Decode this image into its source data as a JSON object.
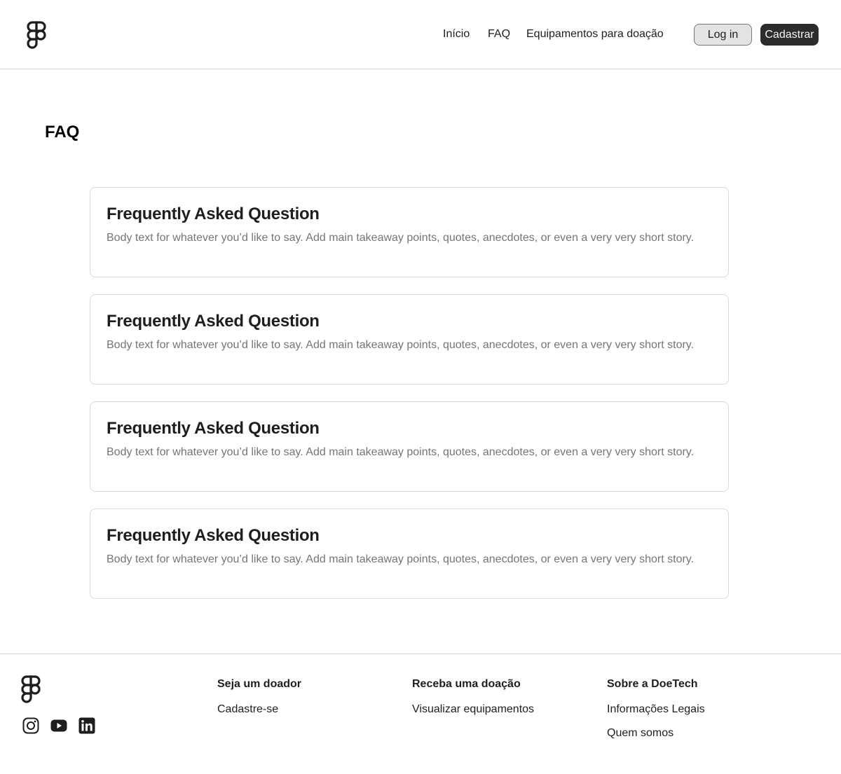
{
  "header": {
    "logo_icon": "figma-logo-icon",
    "nav": {
      "inicio": "Início",
      "faq": "FAQ",
      "equipamentos": "Equipamentos para doação"
    },
    "login_label": "Log in",
    "signup_label": "Cadastrar"
  },
  "main": {
    "title": "FAQ",
    "faqs": [
      {
        "question": "Frequently Asked Question",
        "answer": "Body text for whatever you’d like to say. Add main takeaway points, quotes, anecdotes, or even a very very short story."
      },
      {
        "question": "Frequently Asked Question",
        "answer": "Body text for whatever you’d like to say. Add main takeaway points, quotes, anecdotes, or even a very very short story."
      },
      {
        "question": "Frequently Asked Question",
        "answer": "Body text for whatever you’d like to say. Add main takeaway points, quotes, anecdotes, or even a very very short story."
      },
      {
        "question": "Frequently Asked Question",
        "answer": "Body text for whatever you’d like to say. Add main takeaway points, quotes, anecdotes, or even a very very short story."
      }
    ]
  },
  "footer": {
    "logo_icon": "figma-logo-icon",
    "social_icons": [
      "instagram-icon",
      "youtube-icon",
      "linkedin-icon"
    ],
    "columns": [
      {
        "heading": "Seja um doador",
        "links": [
          "Cadastre-se"
        ]
      },
      {
        "heading": "Receba uma doação",
        "links": [
          "Visualizar equipamentos"
        ]
      },
      {
        "heading": "Sobre a DoeTech",
        "links": [
          "Informações Legais",
          "Quem somos"
        ]
      }
    ]
  },
  "colors": {
    "primary_dark": "#2c2c2c",
    "secondary_bg": "#e3e3e3",
    "border": "#d9d9d9",
    "text": "#1e1e1e",
    "muted_text": "#757575"
  }
}
